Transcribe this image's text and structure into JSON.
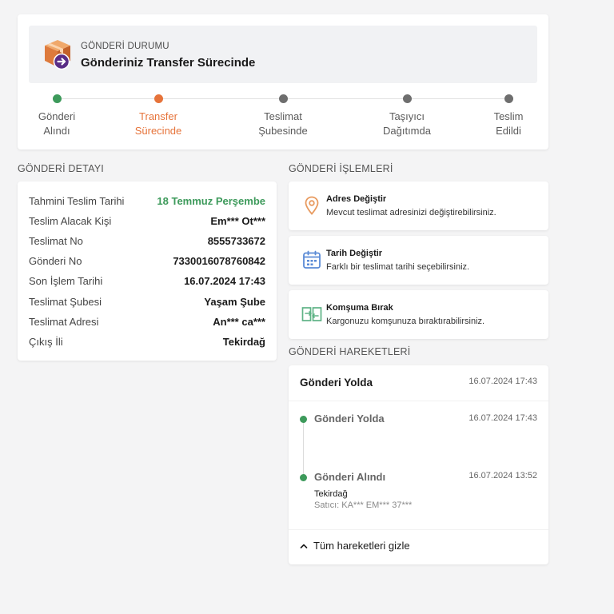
{
  "status": {
    "small_label": "GÖNDERİ DURUMU",
    "title": "Gönderiniz Transfer Sürecinde",
    "steps": [
      {
        "label": "Gönderi Alındı"
      },
      {
        "label": "Transfer Sürecinde"
      },
      {
        "label": "Teslimat Şubesinde"
      },
      {
        "label": "Taşıyıcı Dağıtımda"
      },
      {
        "label": "Teslim Edildi"
      }
    ]
  },
  "detail": {
    "section_title": "GÖNDERİ DETAYI",
    "rows": [
      {
        "label": "Tahmini Teslim Tarihi",
        "value": "18 Temmuz Perşembe"
      },
      {
        "label": "Teslim Alacak Kişi",
        "value": "Em*** Ot***"
      },
      {
        "label": "Teslimat No",
        "value": "8555733672"
      },
      {
        "label": "Gönderi No",
        "value": "7330016078760842"
      },
      {
        "label": "Son İşlem Tarihi",
        "value": "16.07.2024 17:43"
      },
      {
        "label": "Teslimat Şubesi",
        "value": "Yaşam Şube"
      },
      {
        "label": "Teslimat Adresi",
        "value": "An*** ca***"
      },
      {
        "label": "Çıkış İli",
        "value": "Tekirdağ"
      }
    ]
  },
  "actions": {
    "section_title": "GÖNDERİ İŞLEMLERİ",
    "items": [
      {
        "title": "Adres Değiştir",
        "desc": "Mevcut teslimat adresinizi değiştirebilirsiniz.",
        "icon": "location-pin-icon"
      },
      {
        "title": "Tarih Değiştir",
        "desc": "Farklı bir teslimat tarihi seçebilirsiniz.",
        "icon": "calendar-icon"
      },
      {
        "title": "Komşuma Bırak",
        "desc": "Kargonuzu komşunuza bıraktırabilirsiniz.",
        "icon": "neighbor-transfer-icon"
      }
    ]
  },
  "movements": {
    "section_title": "GÖNDERİ HAREKETLERİ",
    "header_title": "Gönderi Yolda",
    "header_date": "16.07.2024 17:43",
    "events": [
      {
        "title": "Gönderi Yolda",
        "date": "16.07.2024 17:43"
      },
      {
        "title": "Gönderi Alındı",
        "date": "16.07.2024 13:52",
        "location": "Tekirdağ",
        "seller": "Satıcı: KA*** EM*** 37***"
      }
    ],
    "toggle_label": "Tüm hareketleri gizle"
  },
  "colors": {
    "green": "#3d9a5b",
    "orange": "#e6733a",
    "grey_dot": "#6e6e6e",
    "icon_orange": "#e89a5f",
    "icon_blue": "#5b8bd6",
    "icon_green": "#5fb386",
    "purple": "#5a2d86"
  }
}
